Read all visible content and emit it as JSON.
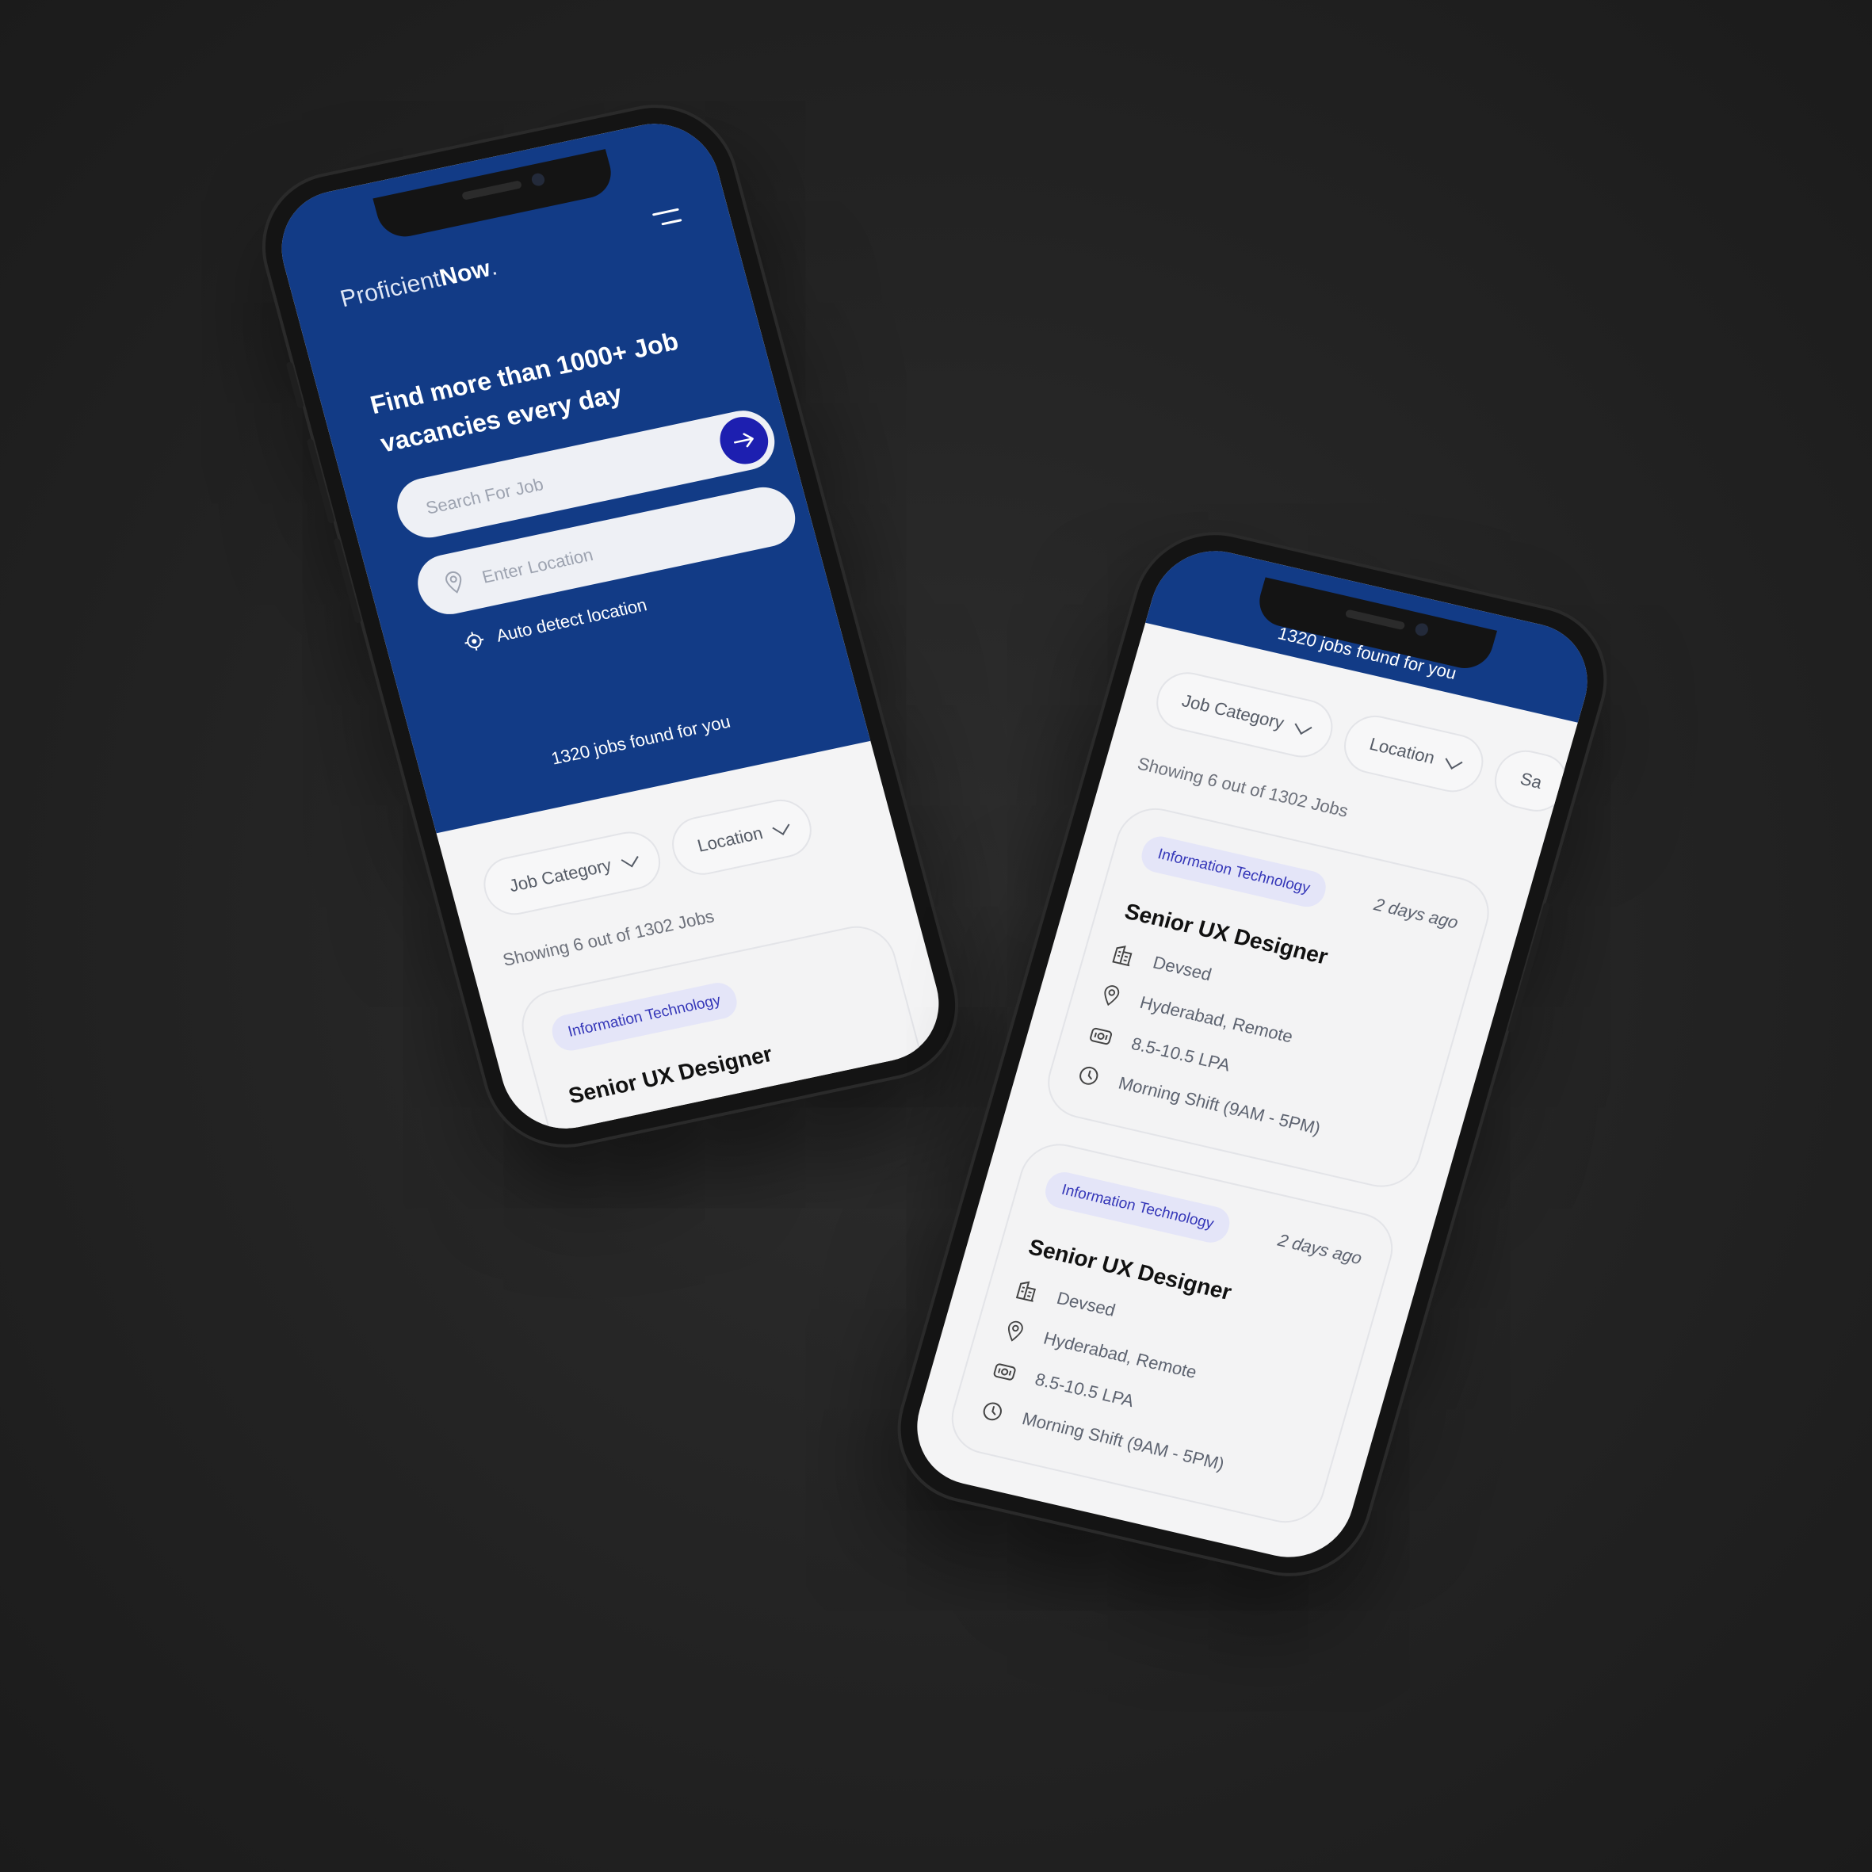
{
  "brand": {
    "light": "Proficient",
    "bold": "Now",
    "dot": "."
  },
  "hero": {
    "headline": "Find more than 1000+ Job vacancies every day",
    "search_placeholder": "Search For Job",
    "location_placeholder": "Enter Location",
    "auto_detect_label": "Auto detect location",
    "jobs_found": "1320 jobs found for you"
  },
  "filters": [
    "Job Category",
    "Location",
    "Sa"
  ],
  "showing_text": "Showing 6 out of 1302 Jobs",
  "jobs": [
    {
      "category": "Information Technology",
      "posted": "2 days ago",
      "title": "Senior UX Designer",
      "company": "Devsed",
      "location": "Hyderabad, Remote",
      "salary": "8.5-10.5 LPA",
      "shift": "Morning Shift (9AM - 5PM)"
    },
    {
      "category": "Information Technology",
      "posted": "2 days ago",
      "title": "Senior UX Designer",
      "company": "Devsed",
      "location": "Hyderabad, Remote",
      "salary": "8.5-10.5 LPA",
      "shift": "Morning Shift (9AM - 5PM)"
    }
  ],
  "colors": {
    "brand_blue": "#123b86",
    "button_blue": "#1d1fb0",
    "tag_text": "#3436b8",
    "tag_bg": "#e4e5f8"
  },
  "icons": [
    "menu-icon",
    "arrow-right-icon",
    "location-pin-icon",
    "crosshair-icon",
    "chevron-down-icon",
    "building-icon",
    "money-icon",
    "clock-icon"
  ]
}
